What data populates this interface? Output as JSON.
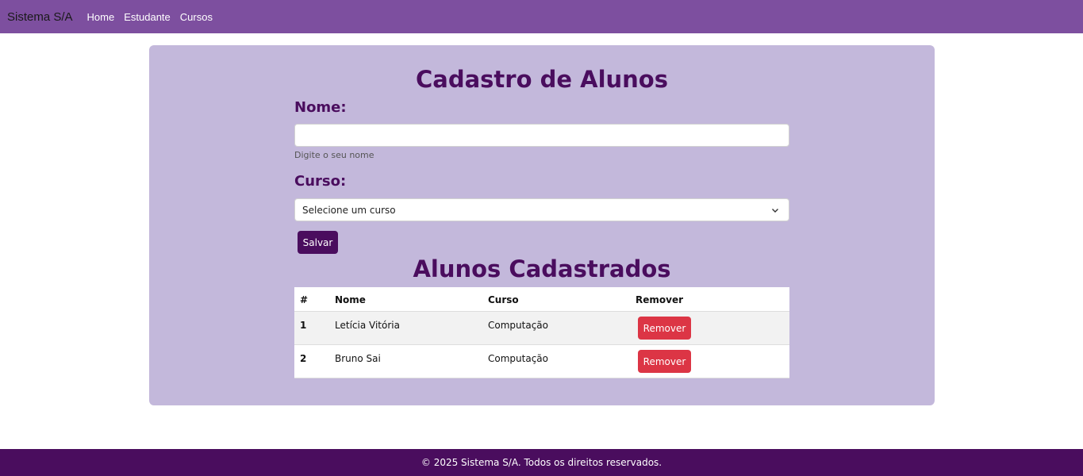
{
  "navbar": {
    "brand": "Sistema S/A",
    "links": [
      {
        "label": "Home"
      },
      {
        "label": "Estudante"
      },
      {
        "label": "Cursos"
      }
    ],
    "color": "#7d4f9f"
  },
  "form": {
    "title": "Cadastro de Alunos",
    "name_label": "Nome:",
    "name_value": "",
    "name_help": "Digite o seu nome",
    "course_label": "Curso:",
    "course_selected": "Selecione um curso",
    "save_label": "Salvar"
  },
  "list": {
    "title": "Alunos Cadastrados",
    "columns": [
      "#",
      "Nome",
      "Curso",
      "Remover"
    ],
    "rows": [
      {
        "id": "1",
        "name": "Letícia Vitória",
        "course": "Computação",
        "action": "Remover"
      },
      {
        "id": "2",
        "name": "Bruno Sai",
        "course": "Computação",
        "action": "Remover"
      }
    ]
  },
  "footer": {
    "text": "© 2025 Sistema S/A. Todos os direitos reservados."
  },
  "colors": {
    "primary": "#4a0d5e",
    "card": "#c3b8db",
    "danger": "#dc3545"
  }
}
